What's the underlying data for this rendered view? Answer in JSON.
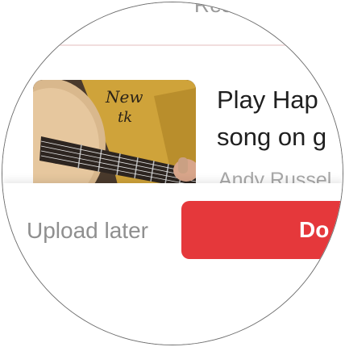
{
  "header": {
    "partial_label": "Rese"
  },
  "video": {
    "title_line1": "Play Hap",
    "title_line2": "song on g",
    "author": "Andy Russel"
  },
  "actions": {
    "upload_later_label": "Upload later",
    "primary_label": "Do"
  },
  "colors": {
    "primary": "#e5383b",
    "title_text": "#1f1f1f",
    "muted_text": "#8f8f8f",
    "divider": "#f1dede"
  }
}
